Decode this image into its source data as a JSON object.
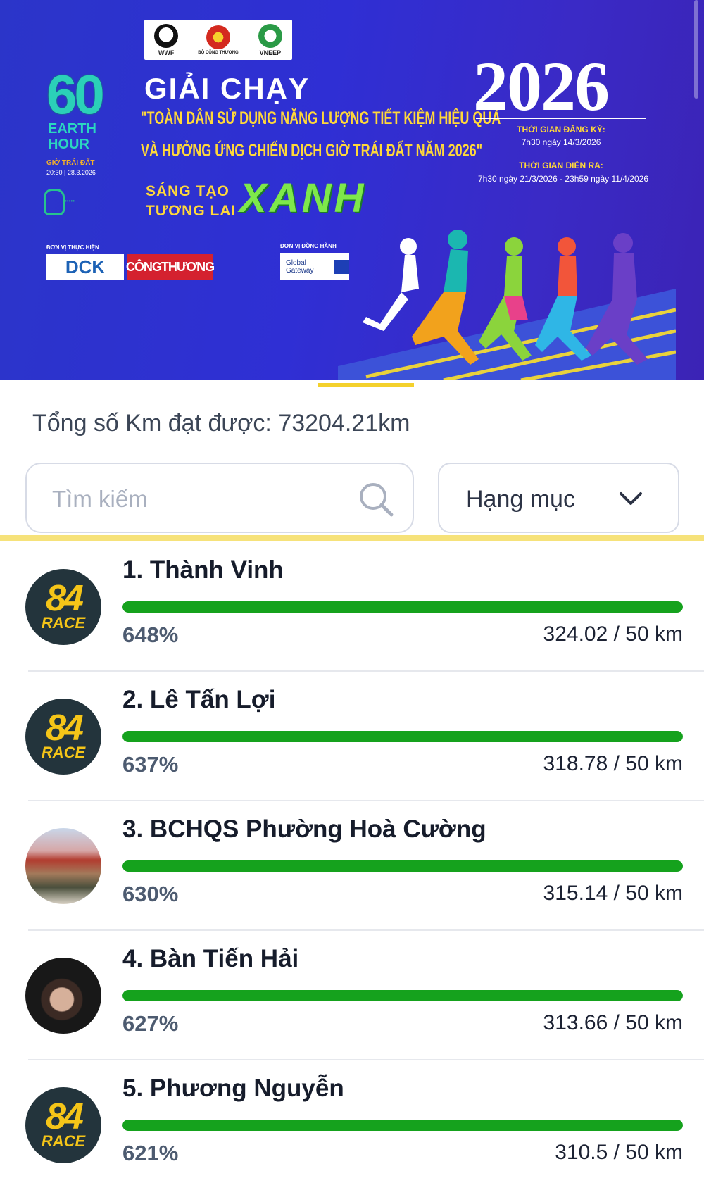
{
  "banner": {
    "logos": [
      "WWF",
      "BỘ CÔNG THƯƠNG",
      "VNEEP"
    ],
    "earth_hour": {
      "number": "60",
      "text": "EARTH HOUR",
      "sub": "GIỜ TRÁI ĐẤT",
      "date": "20:30 | 28.3.2026"
    },
    "title": "GIẢI CHẠY",
    "quote_line1": "\"TOÀN DÂN SỬ DỤNG NĂNG LƯỢNG TIẾT KIỆM HIỆU QUẢ",
    "quote_line2": "VÀ HƯỞNG ỨNG CHIẾN DỊCH GIỜ TRÁI ĐẤT NĂM 2026\"",
    "slogan_left": "SÁNG TẠO TƯƠNG LAI",
    "slogan_right": "XANH",
    "year": "2026",
    "registration_label": "THỜI GIAN ĐĂNG KÝ:",
    "registration_value": "7h30 ngày 14/3/2026",
    "run_label": "THỜI GIAN DIỄN RA:",
    "run_value": "7h30 ngày 21/3/2026 - 23h59 ngày 11/4/2026",
    "organizer_label": "ĐƠN VỊ THỰC HIỆN",
    "organizer_1": "DCK",
    "organizer_2": "CÔNGTHƯƠNG",
    "partner_label": "ĐƠN VỊ ĐỒNG HÀNH",
    "partner": "Global Gateway"
  },
  "total": "Tổng số Km đạt được: 73204.21km",
  "search": {
    "placeholder": "Tìm kiếm"
  },
  "category": {
    "label": "Hạng mục"
  },
  "leaderboard": [
    {
      "rank_name": "1. Thành Vinh",
      "percent": "648%",
      "progress": 1.0,
      "distance": "324.02 / 50 km",
      "avatar": "84 RACE"
    },
    {
      "rank_name": "2. Lê Tấn Lợi",
      "percent": "637%",
      "progress": 1.0,
      "distance": "318.78 / 50 km",
      "avatar": "84 RACE"
    },
    {
      "rank_name": "3. BCHQS Phường Hoà Cường",
      "percent": "630%",
      "progress": 1.0,
      "distance": "315.14 / 50 km",
      "avatar": "photo"
    },
    {
      "rank_name": "4. Bàn Tiến Hải",
      "percent": "627%",
      "progress": 1.0,
      "distance": "313.66 / 50 km",
      "avatar": "photo"
    },
    {
      "rank_name": "5. Phương Nguyễn",
      "percent": "621%",
      "progress": 1.0,
      "distance": "310.5 / 50 km",
      "avatar": "84 RACE"
    }
  ],
  "colors": {
    "progress": "#15a21d",
    "banner": "#2f2fd4",
    "accent": "#f4d12c"
  }
}
